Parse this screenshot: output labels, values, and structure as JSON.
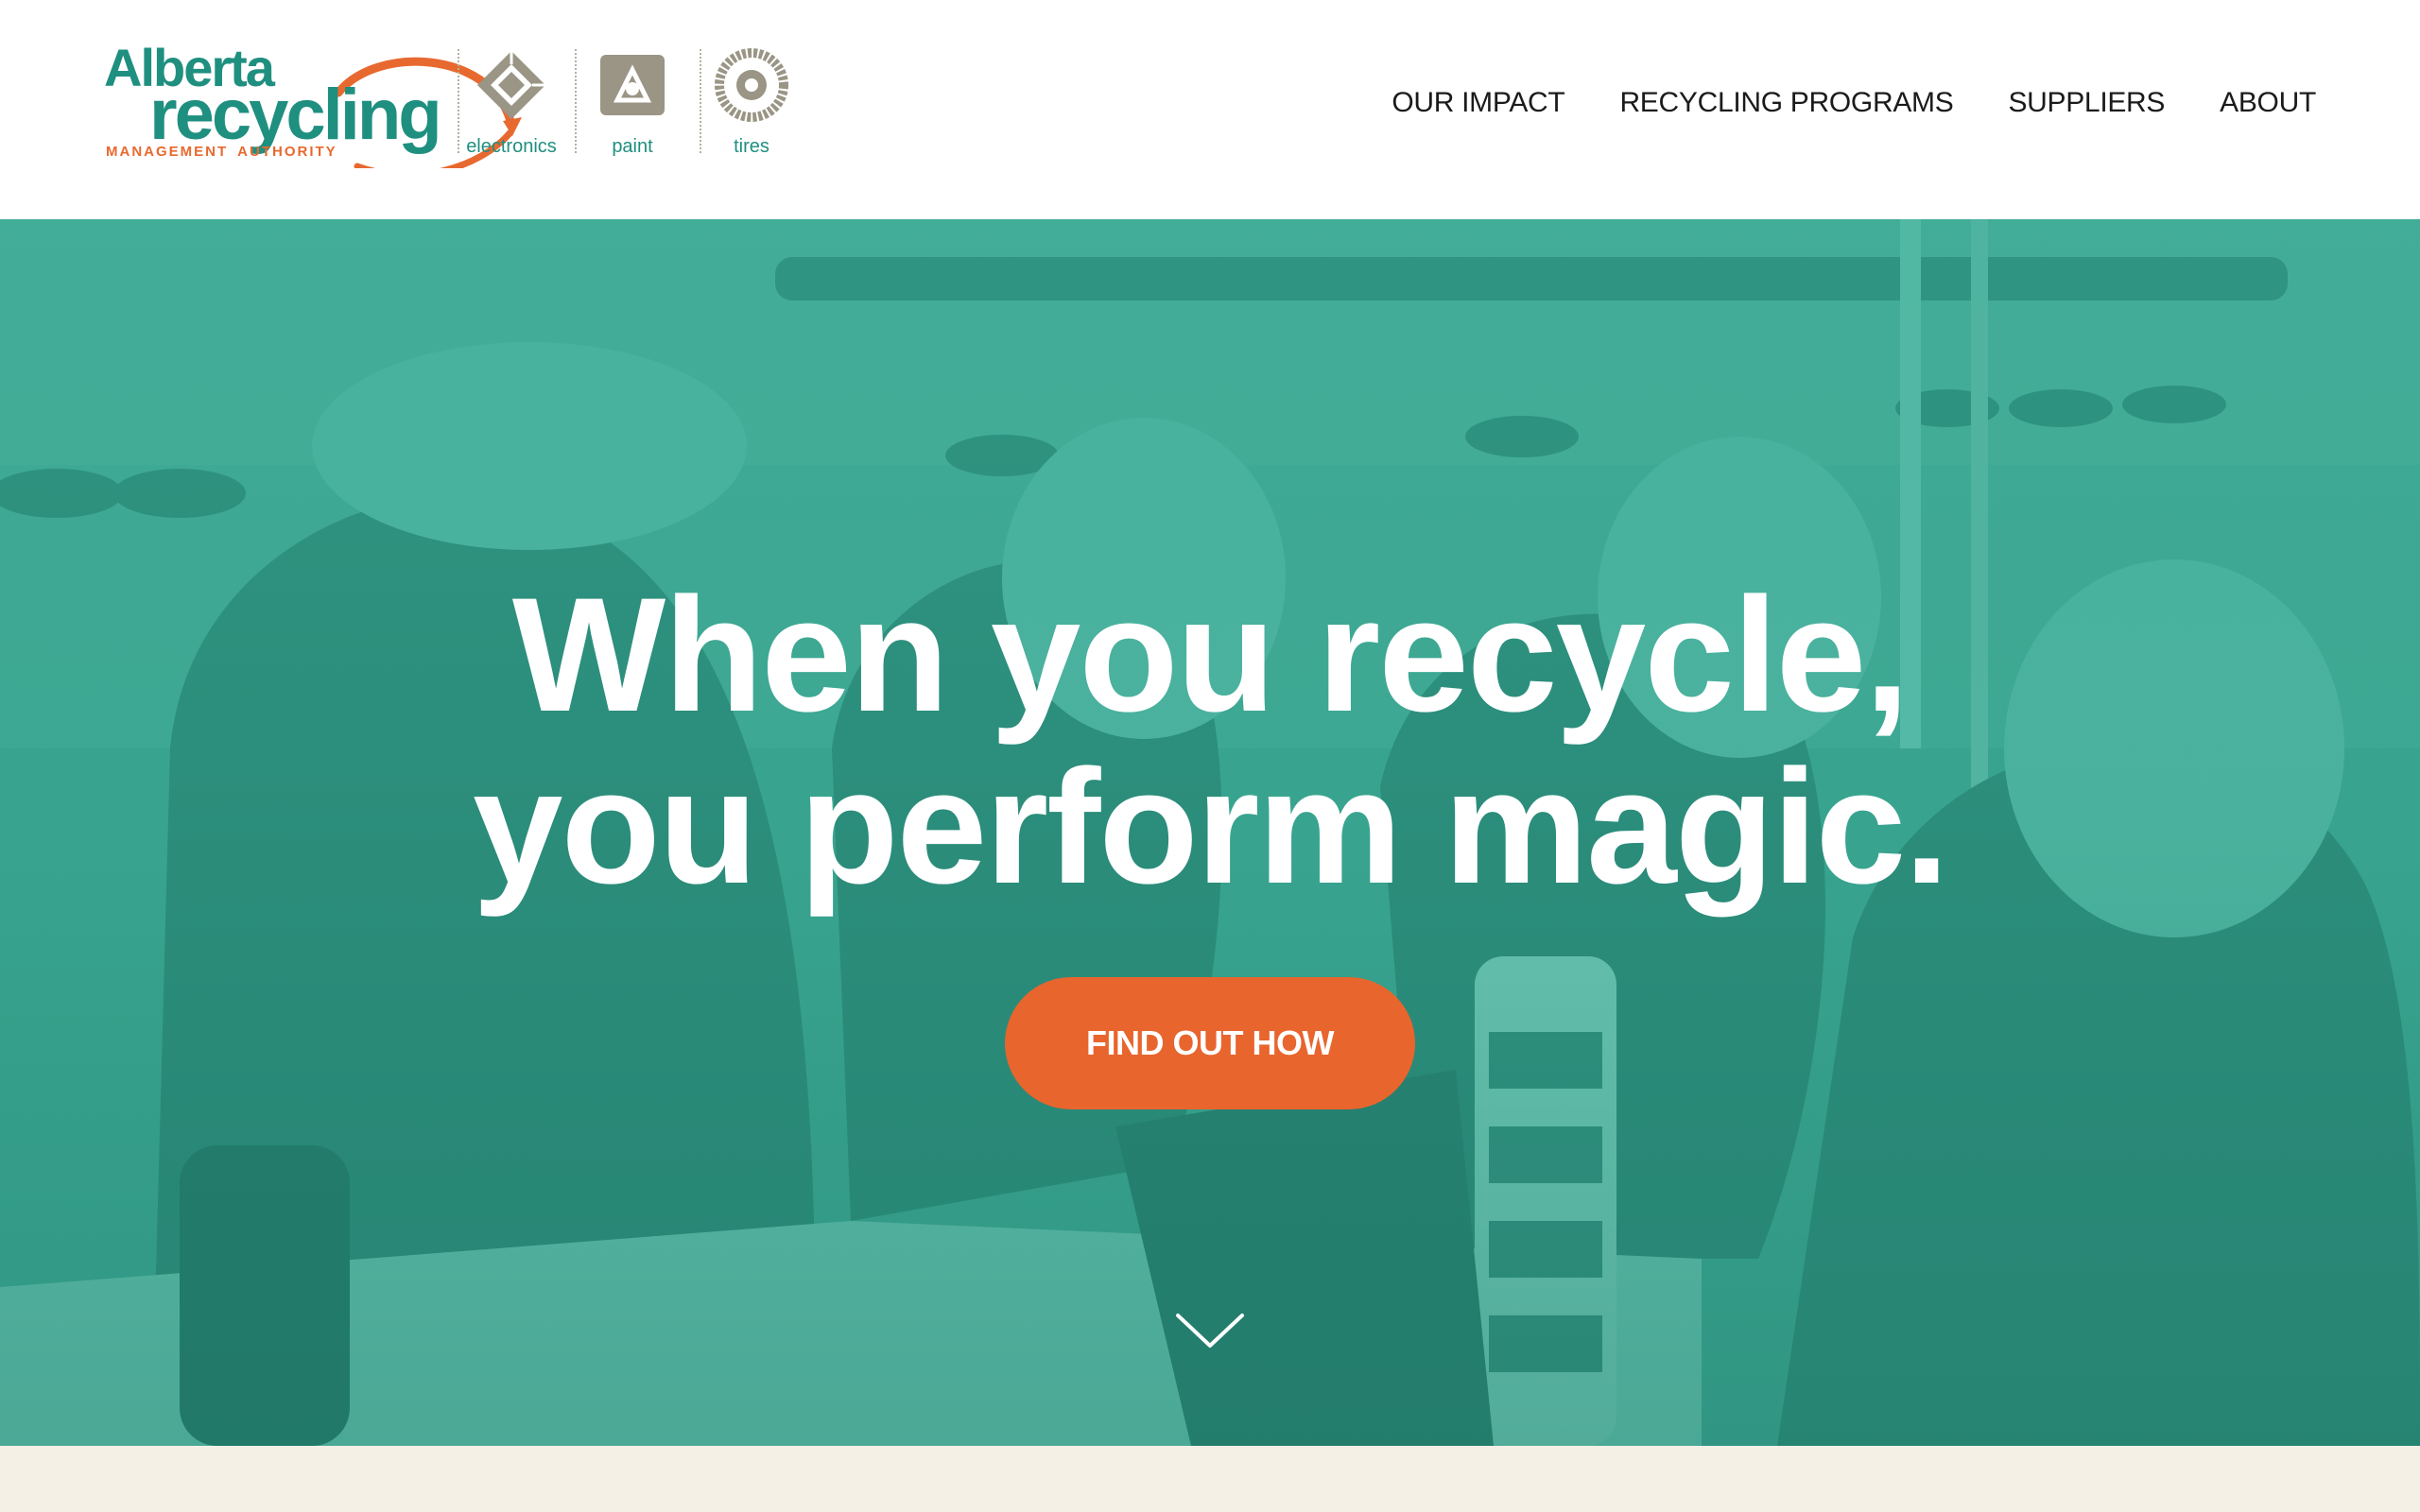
{
  "header": {
    "logo": {
      "line1": "Alberta",
      "line2": "recycling",
      "tagline_left": "MANAGEMENT",
      "tagline_right": "AUTHORITY"
    },
    "programs": [
      {
        "label": "electronics",
        "icon": "electronics-icon"
      },
      {
        "label": "paint",
        "icon": "paint-icon"
      },
      {
        "label": "tires",
        "icon": "tires-icon"
      }
    ],
    "nav": [
      {
        "label": "OUR IMPACT"
      },
      {
        "label": "RECYCLING PROGRAMS"
      },
      {
        "label": "SUPPLIERS"
      },
      {
        "label": "ABOUT"
      }
    ]
  },
  "hero": {
    "headline_line1": "When you recycle,",
    "headline_line2": "you perform magic.",
    "cta_label": "FIND OUT HOW",
    "scroll_icon": "chevron-down-icon"
  },
  "colors": {
    "brand_teal": "#1f8f80",
    "brand_orange": "#e8692f",
    "hero_tint": "#3ba894",
    "cta": "#e8652d",
    "next_section_bg": "#f5f0e6",
    "program_icon_gray": "#9a9585"
  }
}
